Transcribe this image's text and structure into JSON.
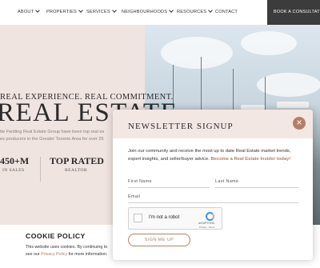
{
  "nav": {
    "items": [
      {
        "label": "ABOUT",
        "has_dropdown": true
      },
      {
        "label": "PROPERTIES",
        "has_dropdown": true
      },
      {
        "label": "SERVICES",
        "has_dropdown": true
      },
      {
        "label": "NEIGHBOURHOODS",
        "has_dropdown": true
      },
      {
        "label": "RESOURCES",
        "has_dropdown": true
      },
      {
        "label": "CONTACT",
        "has_dropdown": false
      }
    ],
    "cta": "BOOK A CONSULTATION"
  },
  "hero": {
    "tagline": "REAL EXPERIENCE. REAL COMMITMENT.",
    "title": "REAL ESTATE",
    "intro_line1": "tte Fielding Real Estate Group have been top real es",
    "intro_line2": "es producers in the Greater Toronto Area for over 25",
    "stats": [
      {
        "value": "450+M",
        "label": "IN SALES"
      },
      {
        "value": "TOP RATED",
        "label": "REALTOR"
      }
    ]
  },
  "cookie": {
    "title": "COOKIE POLICY",
    "line1": "This website uses cookies. By continuing to",
    "line2_prefix": "see our ",
    "policy_link": "Privacy Policy",
    "line2_suffix": " for more information."
  },
  "modal": {
    "title": "NEWSLETTER SIGNUP",
    "description": "Join our community and receive the most up to date Real Estate market trends, expert insights, and seller/buyer advice.",
    "accent_text": "Become a Real Estate Insider today!",
    "close_symbol": "×",
    "fields": {
      "first_name": "First Name",
      "last_name": "Last Name",
      "email": "Email"
    },
    "captcha": {
      "label": "I'm not a robot",
      "brand": "reCAPTCHA",
      "terms": "Privacy - Terms"
    },
    "submit": "SIGN ME UP"
  },
  "colors": {
    "accent": "#b28068",
    "hero_bg": "#f0e4e1",
    "nav_cta_bg": "#3c3c3c"
  }
}
